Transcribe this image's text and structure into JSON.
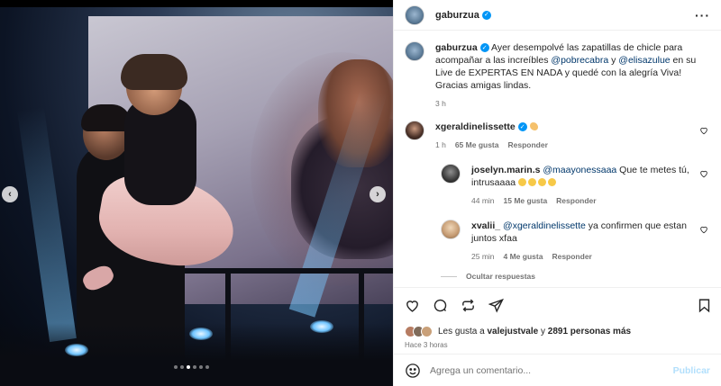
{
  "post": {
    "author": "gaburzua",
    "more_icon": "more-horizontal-icon"
  },
  "caption": {
    "author": "gaburzua",
    "text_1": "Ayer desempolvé las zapatillas de chicle para acompañar a las increíbles ",
    "mention_1": "@pobrecabra",
    "text_2": " y ",
    "mention_2": "@elisazulue",
    "text_3": " en su Live de EXPERTAS EN NADA y quedé con la alegría Viva! Gracias amigas lindas.",
    "time": "3 h"
  },
  "comments": [
    {
      "author": "xgeraldinelissette",
      "time": "1 h",
      "likes": "65 Me gusta",
      "reply_label": "Responder",
      "replies": [
        {
          "author": "joselyn.marin.s",
          "mention": "@maayonessaaa",
          "text": " Que te metes tú, intrusaaaa ",
          "time": "44 min",
          "likes": "15 Me gusta",
          "reply_label": "Responder"
        },
        {
          "author": "xvalii_",
          "mention": "@xgeraldinelissette",
          "text": " ya confirmen que estan juntos xfaa",
          "time": "25 min",
          "likes": "4 Me gusta",
          "reply_label": "Responder"
        }
      ],
      "hide_replies": "Ocultar respuestas"
    }
  ],
  "likes": {
    "prefix": "Les gusta a ",
    "user": "valejustvale",
    "middle": " y ",
    "count": "2891 personas más"
  },
  "time_ago": "Hace 3 horas",
  "composer": {
    "placeholder": "Agrega un comentario...",
    "publish": "Publicar"
  },
  "carousel": {
    "slides": 6,
    "active_index": 2
  },
  "colors": {
    "link": "#00376b",
    "verified": "#0095f6",
    "muted": "#737373",
    "publish_disabled": "#b2dffc"
  }
}
